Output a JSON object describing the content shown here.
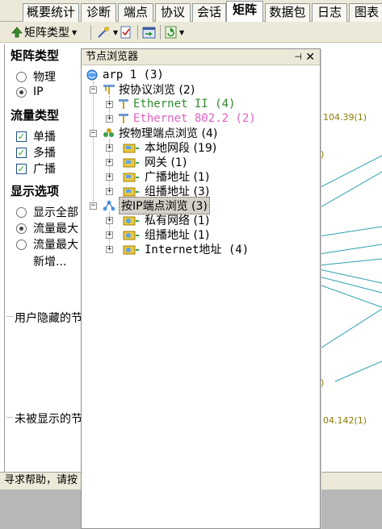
{
  "tabs": [
    "概要统计",
    "诊断",
    "端点",
    "协议",
    "会话",
    "矩阵",
    "数据包",
    "日志",
    "图表"
  ],
  "active_tab": "矩阵",
  "toolbar": {
    "matrix_type_label": "矩阵类型"
  },
  "left_panel": {
    "matrix_type": {
      "title": "矩阵类型",
      "options": [
        {
          "label": "物理",
          "checked": false
        },
        {
          "label": "IP",
          "checked": true
        }
      ]
    },
    "traffic_type": {
      "title": "流量类型",
      "options": [
        {
          "label": "单播",
          "checked": true
        },
        {
          "label": "多播",
          "checked": true
        },
        {
          "label": "广播",
          "checked": true
        }
      ]
    },
    "display_options": {
      "title": "显示选项",
      "options": [
        {
          "label": "显示全部",
          "checked": false
        },
        {
          "label": "流量最大",
          "checked": true
        },
        {
          "label": "流量最大",
          "checked": false
        }
      ],
      "extra_label": "新增..."
    },
    "hidden_group_label": "用户隐藏的节",
    "not_shown_group_label": "未被显示的节"
  },
  "status_bar": "寻求帮助，请按",
  "matrix_labels": [
    "104.39(1)",
    ")",
    ")",
    "04.142(1)"
  ],
  "node_browser": {
    "title": "节点浏览器",
    "pin_glyph": "⊣",
    "close_glyph": "✕",
    "tree": {
      "root": "arp 1 (3)",
      "by_protocol": "按协议浏览 (2)",
      "protocol_items": [
        {
          "label": "Ethernet II (4)",
          "color": "#2e8b2e"
        },
        {
          "label": "Ethernet 802.2 (2)",
          "color": "#e060c0"
        }
      ],
      "by_physical": "按物理端点浏览 (4)",
      "physical_items": [
        "本地网段 (19)",
        "网关 (1)",
        "广播地址 (1)",
        "组播地址 (3)"
      ],
      "by_ip": "按IP端点浏览 (3)",
      "ip_items": [
        "私有网络 (1)",
        "组播地址 (1)",
        "Internet地址 (4)"
      ]
    }
  }
}
